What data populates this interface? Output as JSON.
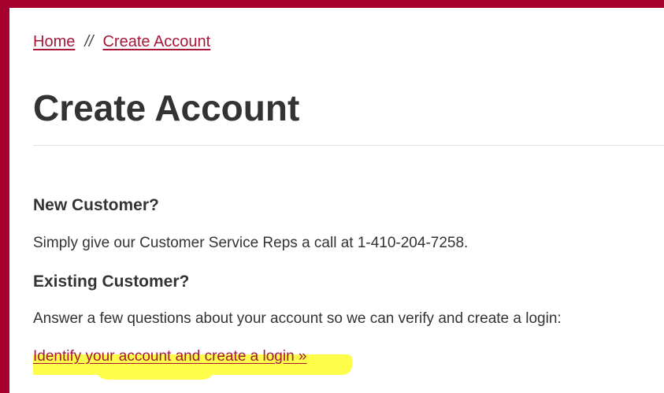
{
  "breadcrumb": {
    "home_label": "Home",
    "separator": "//",
    "current_label": "Create Account"
  },
  "page": {
    "title": "Create Account"
  },
  "new_customer": {
    "heading": "New Customer?",
    "text": "Simply give our Customer Service Reps a call at 1-410-204-7258."
  },
  "existing_customer": {
    "heading": "Existing Customer?",
    "text": "Answer a few questions about your account so we can verify and create a login:",
    "link_label": "Identify your account and create a login »"
  },
  "colors": {
    "frame": "#a6002f",
    "link": "#a6173a",
    "highlight": "#fdfd4a",
    "text": "#333333"
  }
}
